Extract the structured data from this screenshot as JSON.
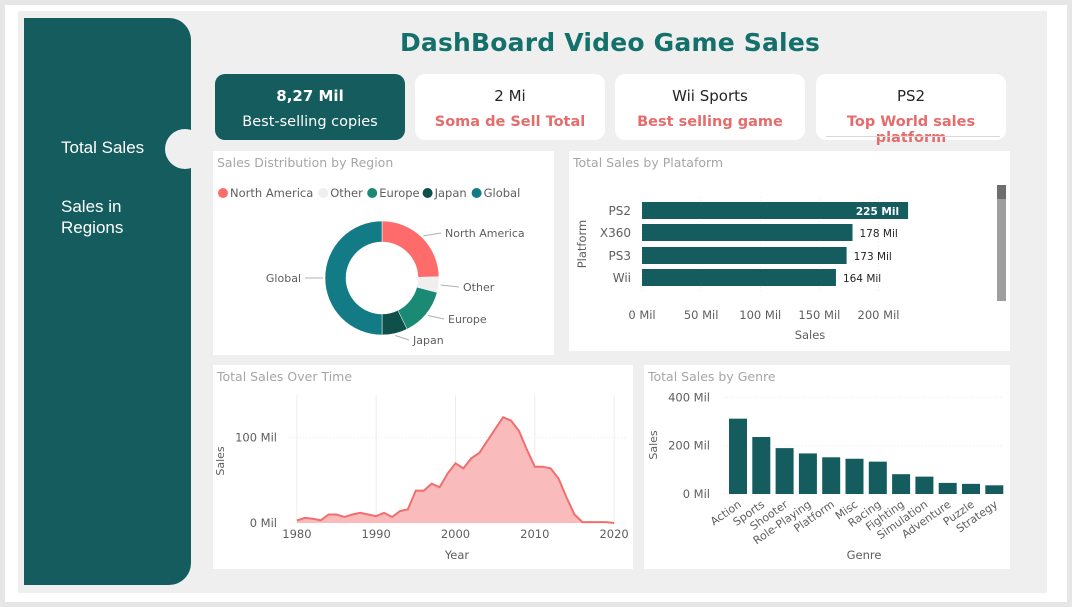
{
  "title": "DashBoard Video Game Sales",
  "sidebar": {
    "items": [
      {
        "label": "Total Sales"
      },
      {
        "label": "Sales in Regions"
      }
    ]
  },
  "cards": [
    {
      "value": "8,27 Mil",
      "label": "Best-selling copies"
    },
    {
      "value": "2 Mi",
      "label": "Soma de Sell Total"
    },
    {
      "value": "Wii Sports",
      "label": "Best selling game"
    },
    {
      "value": "PS2",
      "label": "Top World sales platform"
    }
  ],
  "colors": {
    "teal": "#145c5e",
    "accent_red": "#e66c6c",
    "north_america": "#fd6b6b",
    "other": "#f1eeee",
    "europe": "#1b8a74",
    "japan": "#0f504b",
    "global": "#127b85",
    "area": "#f26e6e"
  },
  "chart_data": [
    {
      "type": "pie",
      "title": "Sales Distribution by Region",
      "legend": [
        "North America",
        "Other",
        "Europe",
        "Japan",
        "Global"
      ],
      "slices": [
        {
          "name": "North America",
          "value": 4402
        },
        {
          "name": "Other",
          "value": 787
        },
        {
          "name": "Europe",
          "value": 2435
        },
        {
          "name": "Japan",
          "value": 1290
        },
        {
          "name": "Global",
          "value": 8920
        }
      ],
      "legend_position": "top-left"
    },
    {
      "type": "bar",
      "orientation": "horizontal",
      "title": "Total Sales by Plataform",
      "ylabel": "Platform",
      "xlabel": "Sales",
      "categories": [
        "PS2",
        "X360",
        "PS3",
        "Wii"
      ],
      "values": [
        225,
        178,
        173,
        164
      ],
      "value_labels": [
        "225 Mil",
        "178 Mil",
        "173 Mil",
        "164 Mil"
      ],
      "xticks": [
        "0 Mil",
        "50 Mil",
        "100 Mil",
        "150 Mil",
        "200 Mil"
      ],
      "xlim": [
        0,
        230
      ]
    },
    {
      "type": "area",
      "title": "Total Sales Over Time",
      "xlabel": "Year",
      "ylabel": "Sales",
      "xticks": [
        "1980",
        "1990",
        "2000",
        "2010",
        "2020"
      ],
      "yticks": [
        "0 Mil",
        "100 Mil"
      ],
      "x": [
        1980,
        1981,
        1982,
        1983,
        1984,
        1985,
        1986,
        1987,
        1988,
        1989,
        1990,
        1991,
        1992,
        1993,
        1994,
        1995,
        1996,
        1997,
        1998,
        1999,
        2000,
        2001,
        2002,
        2003,
        2004,
        2005,
        2006,
        2007,
        2008,
        2009,
        2010,
        2011,
        2012,
        2013,
        2014,
        2015,
        2016,
        2017,
        2018,
        2019,
        2020
      ],
      "values": [
        3,
        6,
        5,
        3,
        10,
        10,
        7,
        10,
        12,
        10,
        8,
        12,
        7,
        14,
        16,
        38,
        38,
        46,
        42,
        58,
        70,
        64,
        76,
        82,
        96,
        110,
        124,
        120,
        108,
        86,
        66,
        66,
        64,
        52,
        30,
        10,
        1,
        1,
        1,
        1,
        0
      ],
      "xlim": [
        1978.5,
        2021.5
      ],
      "ylim": [
        0,
        150
      ]
    },
    {
      "type": "bar",
      "title": "Total Sales by Genre",
      "xlabel": "Genre",
      "ylabel": "Sales",
      "categories": [
        "Action",
        "Sports",
        "Shooter",
        "Role-Playing",
        "Platform",
        "Misc",
        "Racing",
        "Fighting",
        "Simulation",
        "Adventure",
        "Puzzle",
        "Strategy"
      ],
      "values": [
        312,
        236,
        190,
        168,
        152,
        146,
        134,
        82,
        72,
        46,
        42,
        36
      ],
      "yticks": [
        "0 Mil",
        "200 Mil",
        "400 Mil"
      ],
      "ylim": [
        0,
        410
      ]
    }
  ]
}
